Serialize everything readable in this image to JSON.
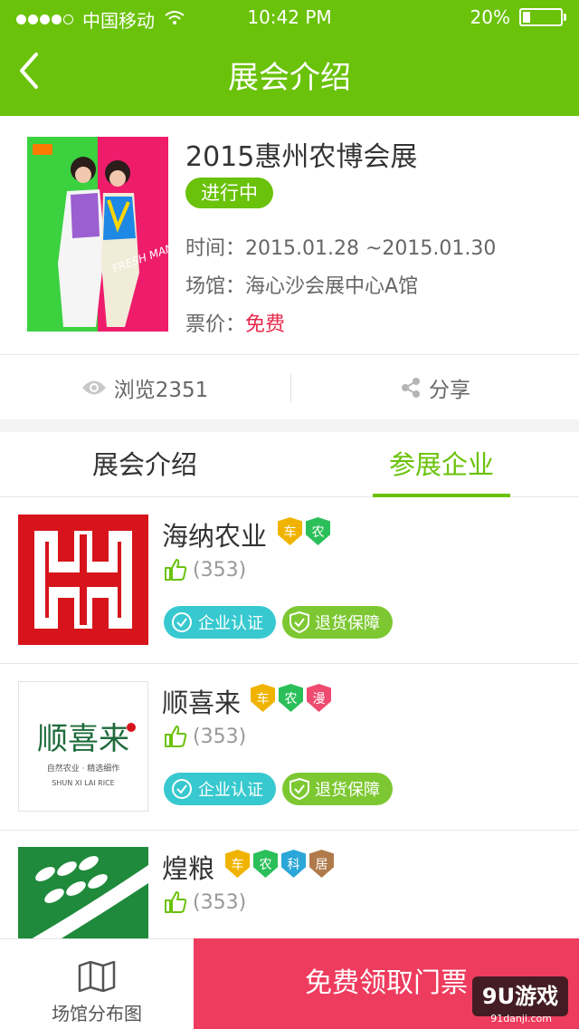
{
  "status_bar": {
    "carrier": "中国移动",
    "time": "10:42 PM",
    "battery": "20%",
    "battery_level": 0.2
  },
  "nav": {
    "title": "展会介绍",
    "back_icon": "chevron-left-icon"
  },
  "expo": {
    "title": "2015惠州农博会展",
    "status": "进行中",
    "time_label": "时间：",
    "time_value": "2015.01.28 ~2015.01.30",
    "venue_label": "场馆：",
    "venue_value": "海心沙会展中心A馆",
    "price_label": "票价：",
    "price_value": "免费",
    "poster_text": "FRESH MAN SHANSHAN"
  },
  "stats": {
    "views": "浏览2351",
    "share": "分享"
  },
  "tabs": {
    "intro": "展会介绍",
    "companies": "参展企业"
  },
  "companies": [
    {
      "name": "海纳农业",
      "badges": [
        {
          "text": "车",
          "color": "#f0b400"
        },
        {
          "text": "农",
          "color": "#2bbf5a"
        }
      ],
      "likes": "(353)",
      "cert": "企业认证",
      "return": "退货保障"
    },
    {
      "name": "顺喜来",
      "badges": [
        {
          "text": "车",
          "color": "#f0b400"
        },
        {
          "text": "农",
          "color": "#2bbf5a"
        },
        {
          "text": "漫",
          "color": "#ef4a6f"
        }
      ],
      "likes": "(353)",
      "cert": "企业认证",
      "return": "退货保障",
      "logo_text": "顺喜来",
      "logo_sub": "自然农业 · 精选细作",
      "logo_en": "SHUN XI LAI RICE"
    },
    {
      "name": "煌粮",
      "badges": [
        {
          "text": "车",
          "color": "#f0b400"
        },
        {
          "text": "农",
          "color": "#2bbf5a"
        },
        {
          "text": "科",
          "color": "#2aa6d8"
        },
        {
          "text": "居",
          "color": "#b07a4a"
        }
      ],
      "likes": "(353)"
    }
  ],
  "bottom": {
    "floor_plan": "场馆分布图",
    "ticket": "免费领取门票"
  },
  "watermark": {
    "text": "9U游戏",
    "sub": "91danji.com"
  },
  "colors": {
    "brand_green": "#6ac20a",
    "ticket_red": "#ee3c5e",
    "cert_cyan": "#37c9cf",
    "return_green": "#7dc832"
  }
}
